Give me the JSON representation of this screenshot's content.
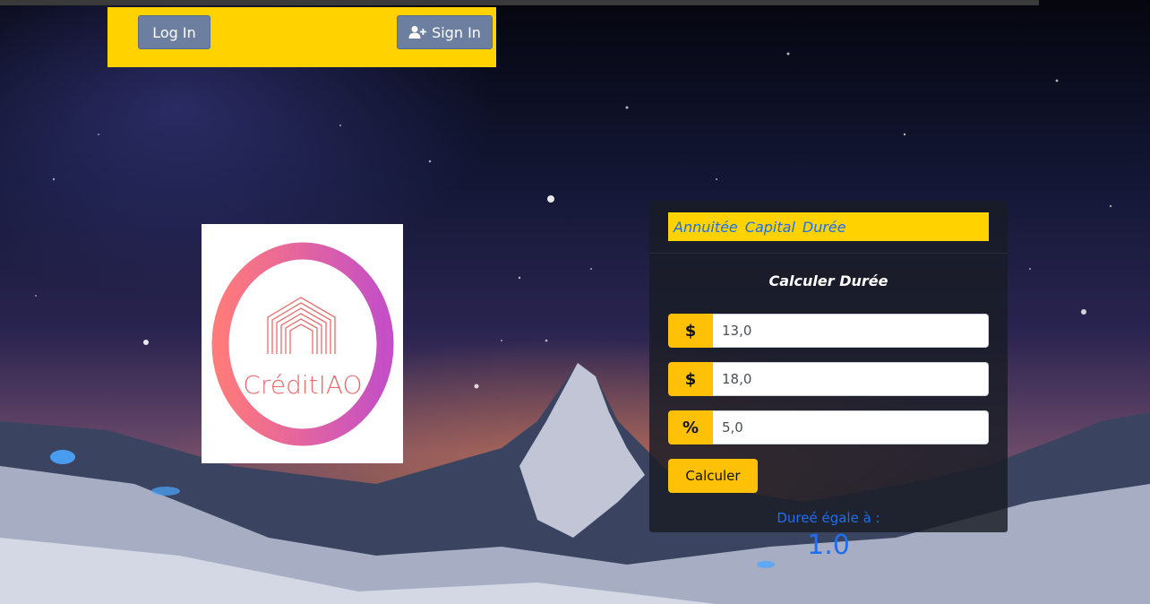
{
  "navbar": {
    "login_label": "Log In",
    "signin_label": "Sign In",
    "accent_color": "#ffd200",
    "button_color": "#6c7fa0"
  },
  "logo": {
    "text": "CréditIAO",
    "icon": "house-arch-logo"
  },
  "calculator": {
    "tabs": [
      "Annuitée",
      "Capital",
      "Durée"
    ],
    "title": "Calculer Durée",
    "inputs": [
      {
        "addon": "$",
        "value": "13,0"
      },
      {
        "addon": "$",
        "value": "18,0"
      },
      {
        "addon": "%",
        "value": "5,0"
      }
    ],
    "button_label": "Calculer",
    "result_label": "Dureé égale à :",
    "result_value": "1.0",
    "accent_color": "#ffc107",
    "link_color": "#1e6ff0"
  }
}
